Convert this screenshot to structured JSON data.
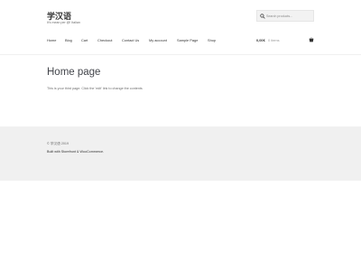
{
  "header": {
    "site_title": "学汉语",
    "site_description": "It's mean per @! Italian"
  },
  "search": {
    "placeholder": "Search products..."
  },
  "nav": {
    "items": [
      "Home",
      "Blog",
      "Cart",
      "Checkout",
      "Contact Us",
      "My account",
      "Sample Page",
      "Shop"
    ]
  },
  "cart": {
    "amount": "0,00€",
    "count": "0 items"
  },
  "main": {
    "title": "Home page",
    "content": "This is your third page. Click the 'edit' link to change the contents"
  },
  "footer": {
    "copyright": "© 学汉语 2019",
    "built_with": "Built with Storefront & WooCommerce."
  },
  "colors": {
    "footer_bg": "#f0f0f0",
    "text": "#43454b"
  }
}
